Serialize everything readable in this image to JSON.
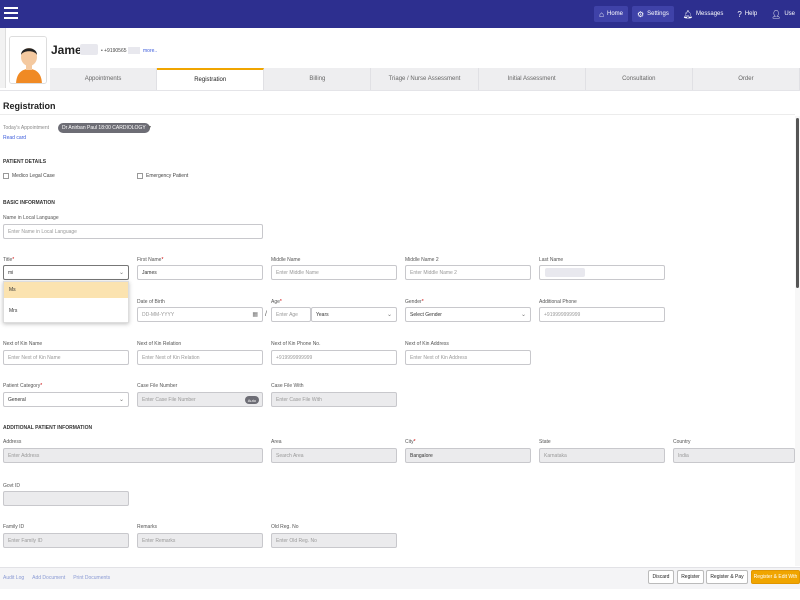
{
  "topbar": {
    "home": "Home",
    "settings": "Settings",
    "messages": "Messages",
    "help": "Help",
    "user": "Use"
  },
  "patient": {
    "name": "James",
    "phone": "+9190565",
    "more": "more.."
  },
  "tabs": [
    "Appointments",
    "Registration",
    "Billing",
    "Triage / Nurse Assessment",
    "Initial Assessment",
    "Consultation",
    "Order"
  ],
  "page": {
    "title": "Registration",
    "today_label": "Today's Appointment",
    "appointment": "Dr Anirban Paul 18:00 CARDIOLOGY",
    "read_card": "Read card"
  },
  "patient_details": {
    "heading": "PATIENT DETAILS",
    "medico_legal": "Medico Legal Case",
    "emergency": "Emergency Patient"
  },
  "basic": {
    "heading": "BASIC INFORMATION",
    "local_name_label": "Name in Local Language",
    "local_name_ph": "Enter Name in Local Language",
    "title_label": "Title",
    "title_value": "mi",
    "title_options": [
      "Ms",
      "Mrs"
    ],
    "first_name_label": "First Name",
    "first_name_value": "James",
    "middle_name_label": "Middle Name",
    "middle_name_ph": "Enter Middle Name",
    "middle_name2_label": "Middle Name 2",
    "middle_name2_ph": "Enter Middle Name 2",
    "last_name_label": "Last Name",
    "dob_label": "Date of Birth",
    "dob_ph": "DD-MM-YYYY",
    "age_label": "Age",
    "age_ph": "Enter Age",
    "age_unit": "Years",
    "gender_label": "Gender",
    "gender_ph": "Select Gender",
    "alt_phone_label": "Additional Phone",
    "alt_phone_ph": "+919999999999",
    "nok_name_label": "Next of Kin Name",
    "nok_name_ph": "Enter Next of Kin Name",
    "nok_rel_label": "Next of Kin Relation",
    "nok_rel_ph": "Enter Next of Kin Relation",
    "nok_phone_label": "Next of Kin Phone No.",
    "nok_phone_ph": "+919999999999",
    "nok_addr_label": "Next of Kin Address",
    "nok_addr_ph": "Enter Next of Kin Address",
    "category_label": "Patient Category",
    "category_value": "General",
    "case_file_label": "Case File Number",
    "case_file_ph": "Enter Case File Number",
    "auto": "Auto",
    "case_with_label": "Case File With",
    "case_with_ph": "Enter Case File With"
  },
  "additional": {
    "heading": "ADDITIONAL PATIENT INFORMATION",
    "address_label": "Address",
    "address_ph": "Enter Address",
    "area_label": "Area",
    "area_ph": "Search Area",
    "city_label": "City",
    "city_value": "Bangalore",
    "state_label": "State",
    "state_value": "Karnataka",
    "country_label": "Country",
    "country_value": "India",
    "govt_id_label": "Govt ID",
    "family_label": "Family ID",
    "family_ph": "Enter Family ID",
    "remarks_label": "Remarks",
    "remarks_ph": "Enter Remarks",
    "old_reg_label": "Old Reg. No",
    "old_reg_ph": "Enter Old Reg. No"
  },
  "footer": {
    "links": [
      "Audit Log",
      "Add Document",
      "Print Documents"
    ],
    "discard": "Discard",
    "register": "Register",
    "register_pay": "Register & Pay",
    "register_edit": "Register & Edit Wth"
  },
  "colors": {
    "topbar": "#2d2f8f",
    "accent": "#f0a500"
  }
}
